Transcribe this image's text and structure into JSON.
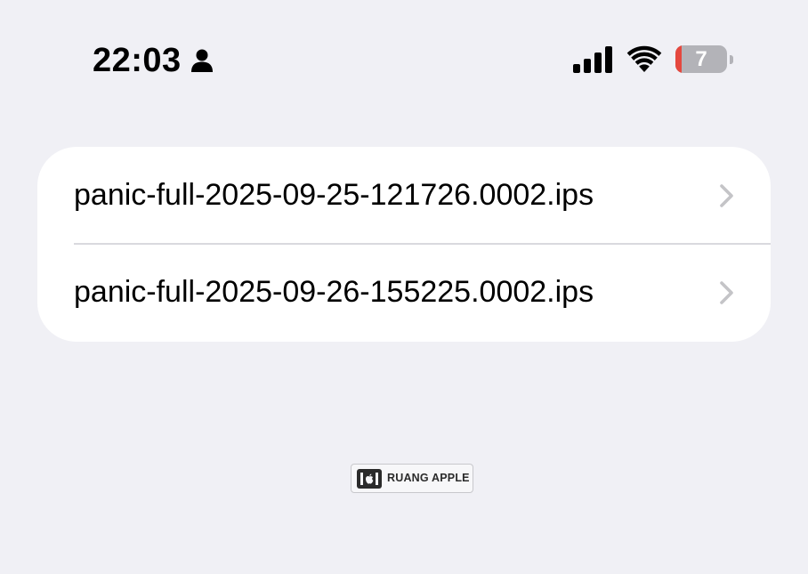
{
  "status_bar": {
    "time": "22:03",
    "battery_level": "7",
    "battery_color": "#e5483e",
    "icons": [
      "person-icon",
      "cellular-signal-icon",
      "wifi-icon",
      "battery-icon"
    ]
  },
  "file_list": {
    "items": [
      {
        "label": "panic-full-2025-09-25-121726.0002.ips",
        "icon": "chevron-right-icon"
      },
      {
        "label": "panic-full-2025-09-26-155225.0002.ips",
        "icon": "chevron-right-icon"
      }
    ]
  },
  "watermark": {
    "text": "RUANG APPLE"
  }
}
